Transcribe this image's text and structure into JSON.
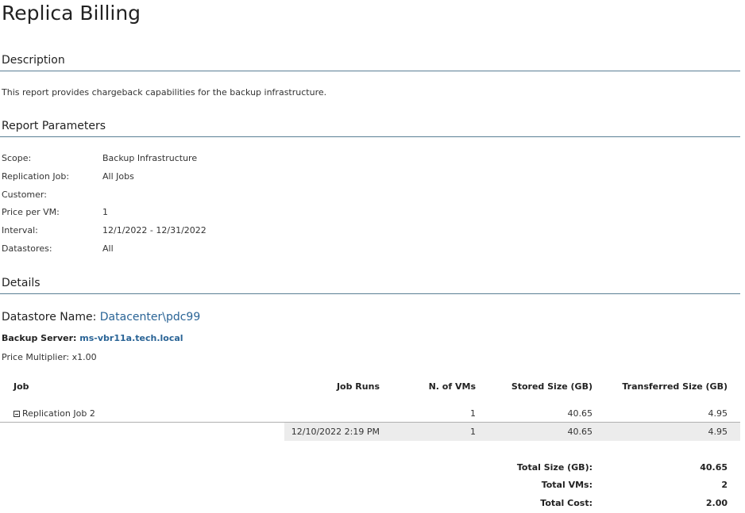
{
  "report": {
    "title": "Replica Billing",
    "description_heading": "Description",
    "description": "This report provides chargeback capabilities for the backup infrastructure.",
    "params_heading": "Report Parameters",
    "params": [
      {
        "label": "Scope:",
        "value": "Backup Infrastructure"
      },
      {
        "label": "Replication Job:",
        "value": "All Jobs"
      },
      {
        "label": "Customer:",
        "value": ""
      },
      {
        "label": "Price per VM:",
        "value": "1"
      },
      {
        "label": "Interval:",
        "value": "12/1/2022 - 12/31/2022"
      },
      {
        "label": "Datastores:",
        "value": "All"
      }
    ],
    "details_heading": "Details"
  },
  "datastore": {
    "label": "Datastore Name:",
    "name": "Datacenter\\pdc99",
    "backup_server_label": "Backup Server:",
    "backup_server": "ms-vbr11a.tech.local",
    "price_multiplier_label": "Price Multiplier:",
    "price_multiplier": "x1.00"
  },
  "table": {
    "headers": {
      "job": "Job",
      "job_runs": "Job Runs",
      "n_vms": "N. of VMs",
      "stored": "Stored Size (GB)",
      "transferred": "Transferred Size (GB)"
    },
    "job_row": {
      "job": "Replication Job 2",
      "job_runs": "",
      "n_vms": "1",
      "stored": "40.65",
      "transferred": "4.95"
    },
    "run_row": {
      "job_runs": "12/10/2022 2:19 PM",
      "n_vms": "1",
      "stored": "40.65",
      "transferred": "4.95"
    }
  },
  "totals": [
    {
      "label": "Total Size (GB):",
      "value": "40.65"
    },
    {
      "label": "Total VMs:",
      "value": "2"
    },
    {
      "label": "Total Cost:",
      "value": "2.00"
    }
  ],
  "colors": {
    "link": "#2a6496",
    "rule": "#5a7f94",
    "row_highlight": "#ececec"
  }
}
